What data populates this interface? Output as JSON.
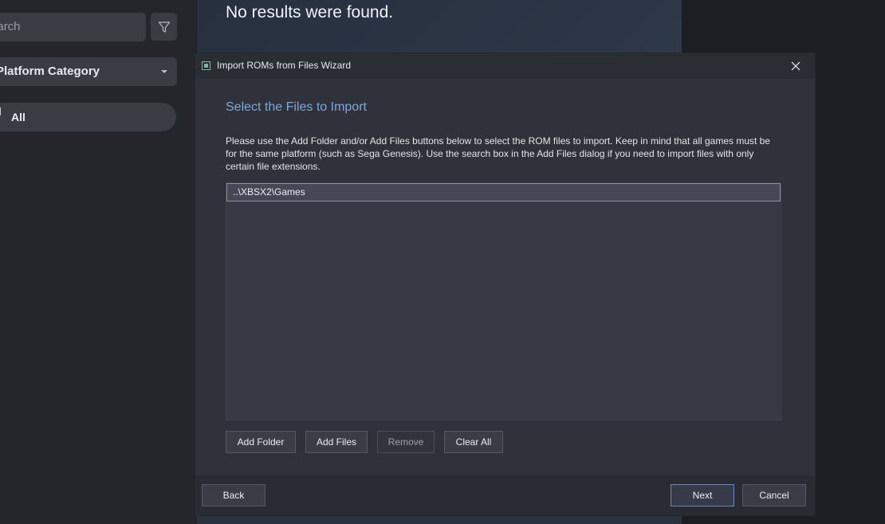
{
  "sidebar": {
    "search_text": "Search",
    "platform_select_label": "Platform Category",
    "all_item_label": "All"
  },
  "content": {
    "no_results": "No results were found."
  },
  "dialog": {
    "title": "Import ROMs from Files Wizard",
    "heading": "Select the Files to Import",
    "description": "Please use the Add Folder and/or Add Files buttons below to select the ROM files to import. Keep in mind that all games must be for the same platform (such as Sega Genesis). Use the search box in the Add Files dialog if you need to import files with only certain file extensions.",
    "files": [
      "..\\XBSX2\\Games"
    ],
    "buttons": {
      "add_folder": "Add Folder",
      "add_files": "Add Files",
      "remove": "Remove",
      "clear_all": "Clear All",
      "back": "Back",
      "next": "Next",
      "cancel": "Cancel"
    }
  },
  "icons": {
    "filter": "filter-funnel-icon",
    "chevron": "chevron-down-icon",
    "close": "close-icon",
    "app": "app-icon"
  },
  "colors": {
    "accent": "#7fa7d8",
    "primary_button_border": "#6b8bbf"
  }
}
